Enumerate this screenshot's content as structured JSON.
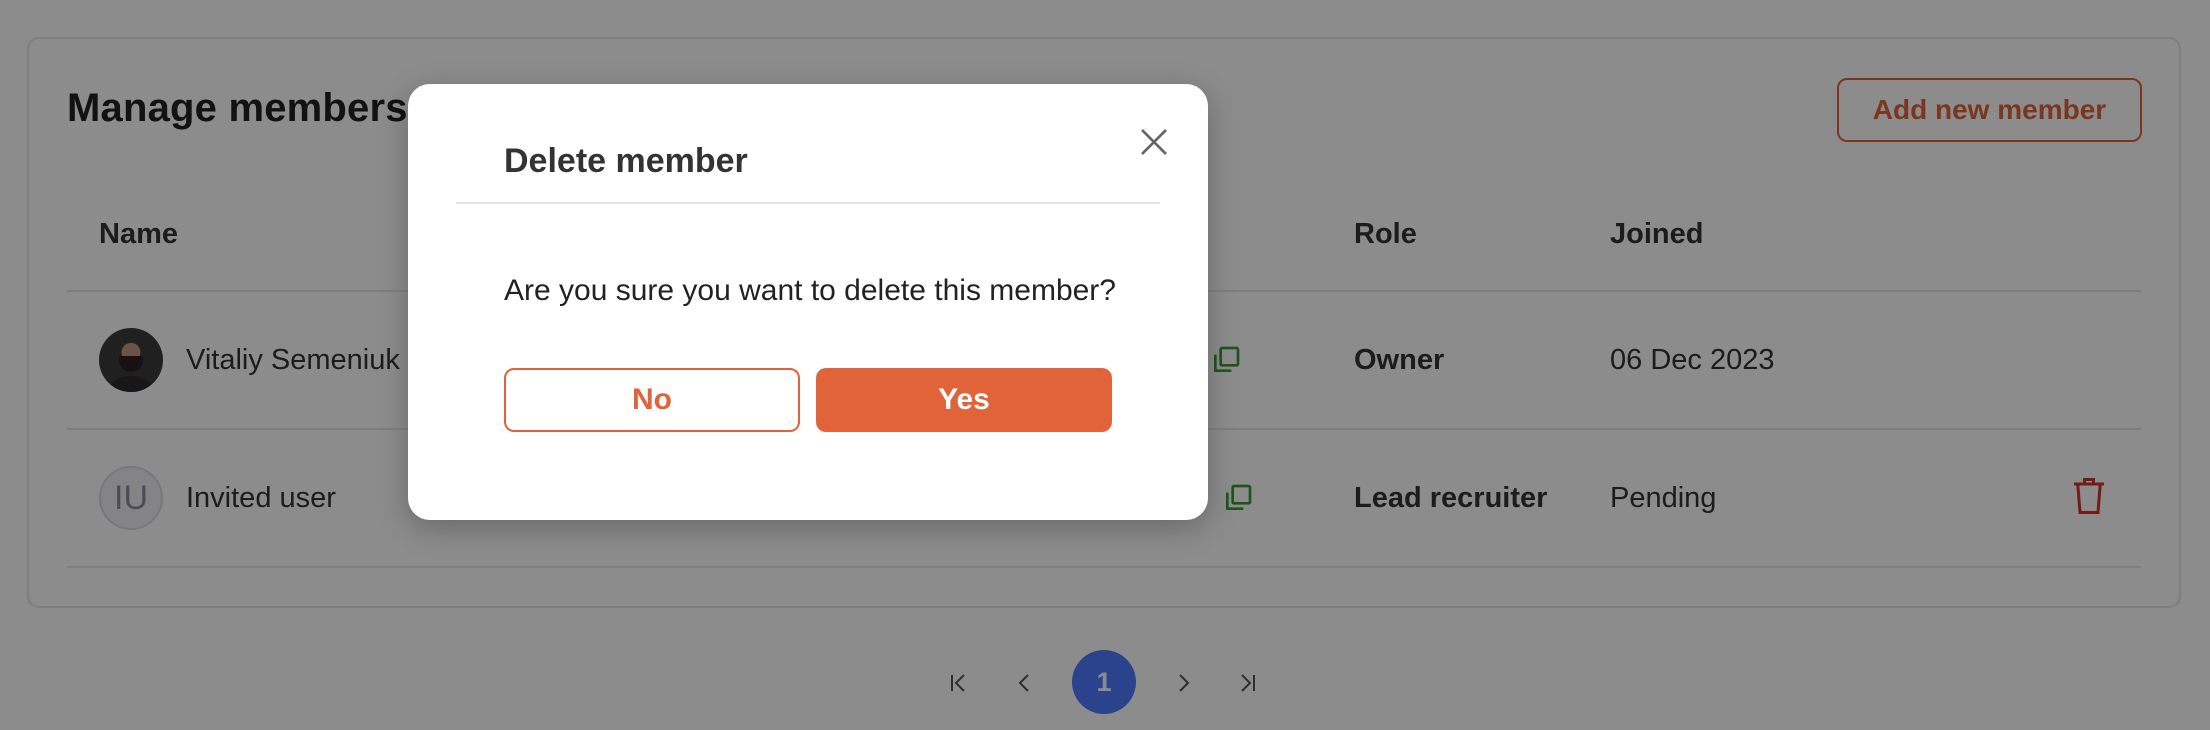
{
  "page": {
    "title": "Manage members",
    "add_button_label": "Add new member"
  },
  "table": {
    "headers": {
      "name": "Name",
      "role": "Role",
      "joined": "Joined"
    },
    "rows": [
      {
        "name": "Vitaliy Semeniuk",
        "avatar": "photo",
        "role": "Owner",
        "joined": "06 Dec 2023",
        "copy_icon": "copy-icon",
        "delete": false
      },
      {
        "name": "Invited user",
        "avatar_initials": "IU",
        "role": "Lead recruiter",
        "joined": "Pending",
        "copy_icon": "copy-icon",
        "delete": true,
        "delete_icon": "trash-icon"
      }
    ]
  },
  "pagination": {
    "current_page": "1",
    "icons": [
      "first-page-icon",
      "prev-page-icon",
      "next-page-icon",
      "last-page-icon"
    ]
  },
  "modal": {
    "title": "Delete member",
    "message": "Are you sure you want to delete this member?",
    "no_label": "No",
    "yes_label": "Yes",
    "close_icon": "close-icon"
  },
  "colors": {
    "accent": "#e0633a",
    "page_active": "#4f7bff",
    "copy_icon": "#3a9a3a",
    "delete_icon": "#d0342c",
    "overlay": "rgba(0,0,0,0.45)"
  }
}
